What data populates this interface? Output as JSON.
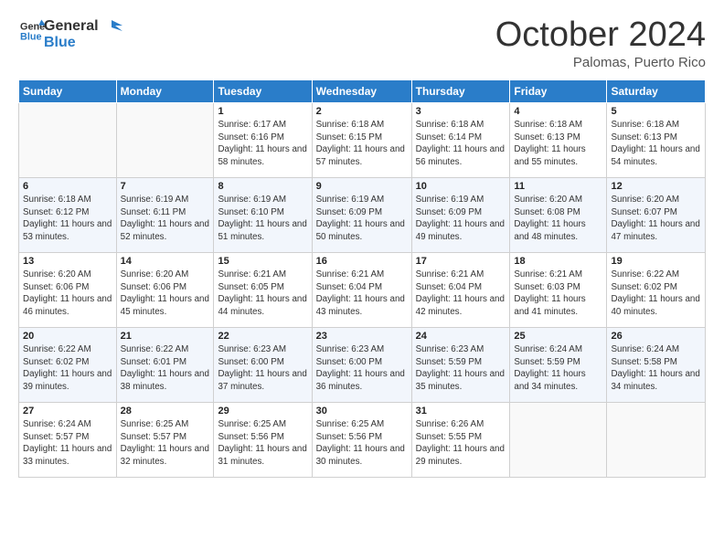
{
  "logo": {
    "text1": "General",
    "text2": "Blue"
  },
  "title": "October 2024",
  "subtitle": "Palomas, Puerto Rico",
  "days_header": [
    "Sunday",
    "Monday",
    "Tuesday",
    "Wednesday",
    "Thursday",
    "Friday",
    "Saturday"
  ],
  "weeks": [
    [
      {
        "day": "",
        "info": ""
      },
      {
        "day": "",
        "info": ""
      },
      {
        "day": "1",
        "info": "Sunrise: 6:17 AM\nSunset: 6:16 PM\nDaylight: 11 hours and 58 minutes."
      },
      {
        "day": "2",
        "info": "Sunrise: 6:18 AM\nSunset: 6:15 PM\nDaylight: 11 hours and 57 minutes."
      },
      {
        "day": "3",
        "info": "Sunrise: 6:18 AM\nSunset: 6:14 PM\nDaylight: 11 hours and 56 minutes."
      },
      {
        "day": "4",
        "info": "Sunrise: 6:18 AM\nSunset: 6:13 PM\nDaylight: 11 hours and 55 minutes."
      },
      {
        "day": "5",
        "info": "Sunrise: 6:18 AM\nSunset: 6:13 PM\nDaylight: 11 hours and 54 minutes."
      }
    ],
    [
      {
        "day": "6",
        "info": "Sunrise: 6:18 AM\nSunset: 6:12 PM\nDaylight: 11 hours and 53 minutes."
      },
      {
        "day": "7",
        "info": "Sunrise: 6:19 AM\nSunset: 6:11 PM\nDaylight: 11 hours and 52 minutes."
      },
      {
        "day": "8",
        "info": "Sunrise: 6:19 AM\nSunset: 6:10 PM\nDaylight: 11 hours and 51 minutes."
      },
      {
        "day": "9",
        "info": "Sunrise: 6:19 AM\nSunset: 6:09 PM\nDaylight: 11 hours and 50 minutes."
      },
      {
        "day": "10",
        "info": "Sunrise: 6:19 AM\nSunset: 6:09 PM\nDaylight: 11 hours and 49 minutes."
      },
      {
        "day": "11",
        "info": "Sunrise: 6:20 AM\nSunset: 6:08 PM\nDaylight: 11 hours and 48 minutes."
      },
      {
        "day": "12",
        "info": "Sunrise: 6:20 AM\nSunset: 6:07 PM\nDaylight: 11 hours and 47 minutes."
      }
    ],
    [
      {
        "day": "13",
        "info": "Sunrise: 6:20 AM\nSunset: 6:06 PM\nDaylight: 11 hours and 46 minutes."
      },
      {
        "day": "14",
        "info": "Sunrise: 6:20 AM\nSunset: 6:06 PM\nDaylight: 11 hours and 45 minutes."
      },
      {
        "day": "15",
        "info": "Sunrise: 6:21 AM\nSunset: 6:05 PM\nDaylight: 11 hours and 44 minutes."
      },
      {
        "day": "16",
        "info": "Sunrise: 6:21 AM\nSunset: 6:04 PM\nDaylight: 11 hours and 43 minutes."
      },
      {
        "day": "17",
        "info": "Sunrise: 6:21 AM\nSunset: 6:04 PM\nDaylight: 11 hours and 42 minutes."
      },
      {
        "day": "18",
        "info": "Sunrise: 6:21 AM\nSunset: 6:03 PM\nDaylight: 11 hours and 41 minutes."
      },
      {
        "day": "19",
        "info": "Sunrise: 6:22 AM\nSunset: 6:02 PM\nDaylight: 11 hours and 40 minutes."
      }
    ],
    [
      {
        "day": "20",
        "info": "Sunrise: 6:22 AM\nSunset: 6:02 PM\nDaylight: 11 hours and 39 minutes."
      },
      {
        "day": "21",
        "info": "Sunrise: 6:22 AM\nSunset: 6:01 PM\nDaylight: 11 hours and 38 minutes."
      },
      {
        "day": "22",
        "info": "Sunrise: 6:23 AM\nSunset: 6:00 PM\nDaylight: 11 hours and 37 minutes."
      },
      {
        "day": "23",
        "info": "Sunrise: 6:23 AM\nSunset: 6:00 PM\nDaylight: 11 hours and 36 minutes."
      },
      {
        "day": "24",
        "info": "Sunrise: 6:23 AM\nSunset: 5:59 PM\nDaylight: 11 hours and 35 minutes."
      },
      {
        "day": "25",
        "info": "Sunrise: 6:24 AM\nSunset: 5:59 PM\nDaylight: 11 hours and 34 minutes."
      },
      {
        "day": "26",
        "info": "Sunrise: 6:24 AM\nSunset: 5:58 PM\nDaylight: 11 hours and 34 minutes."
      }
    ],
    [
      {
        "day": "27",
        "info": "Sunrise: 6:24 AM\nSunset: 5:57 PM\nDaylight: 11 hours and 33 minutes."
      },
      {
        "day": "28",
        "info": "Sunrise: 6:25 AM\nSunset: 5:57 PM\nDaylight: 11 hours and 32 minutes."
      },
      {
        "day": "29",
        "info": "Sunrise: 6:25 AM\nSunset: 5:56 PM\nDaylight: 11 hours and 31 minutes."
      },
      {
        "day": "30",
        "info": "Sunrise: 6:25 AM\nSunset: 5:56 PM\nDaylight: 11 hours and 30 minutes."
      },
      {
        "day": "31",
        "info": "Sunrise: 6:26 AM\nSunset: 5:55 PM\nDaylight: 11 hours and 29 minutes."
      },
      {
        "day": "",
        "info": ""
      },
      {
        "day": "",
        "info": ""
      }
    ]
  ]
}
